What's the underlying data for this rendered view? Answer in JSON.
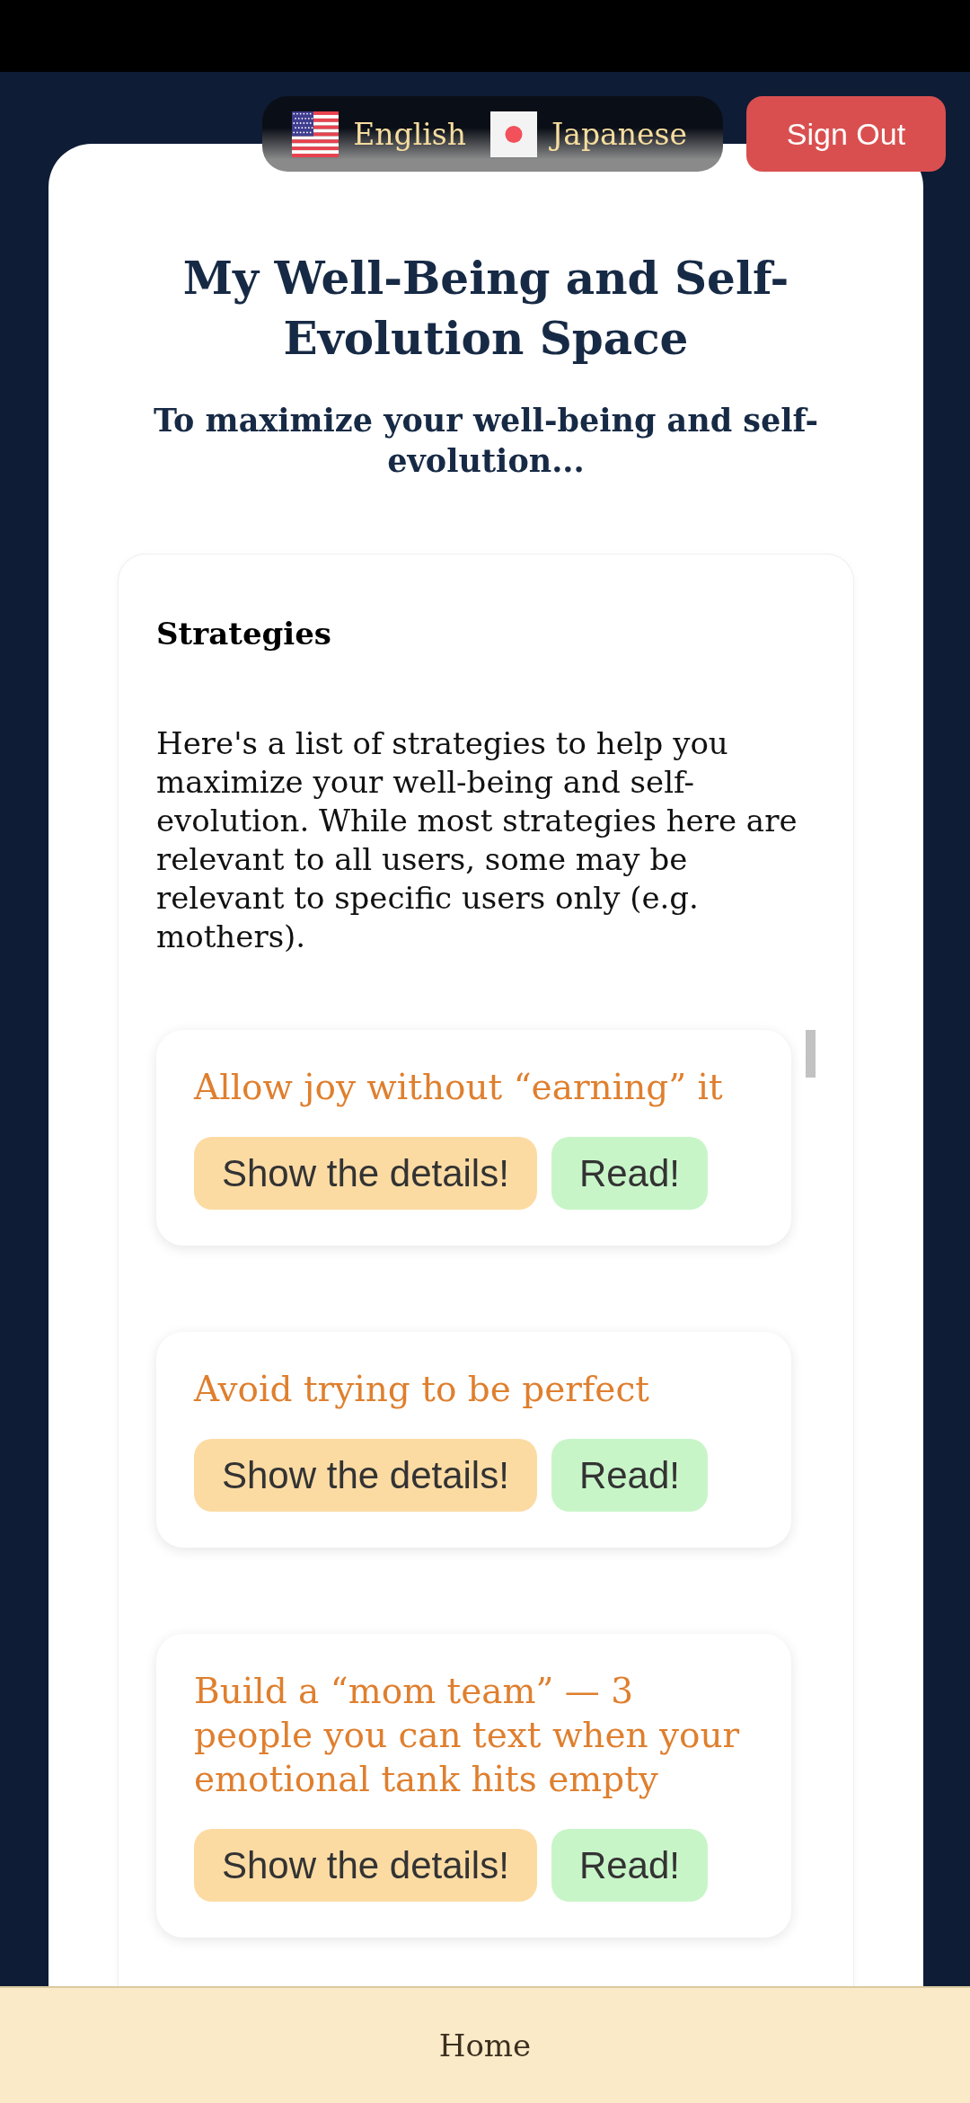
{
  "language_switcher": {
    "options": [
      {
        "label": "English",
        "kind": "us"
      },
      {
        "label": "Japanese",
        "kind": "jp"
      }
    ]
  },
  "sign_out_button": {
    "label": "Sign Out"
  },
  "header": {
    "title": "My Well-Being and Self-Evolution Space",
    "subtitle": "To maximize your well-being and self-evolution..."
  },
  "strategies": {
    "heading": "Strategies",
    "description": "Here's a list of strategies to help you maximize your well-being and self-evolution. While most strategies here are relevant to all users, some may be relevant to specific users only (e.g. mothers).",
    "items": [
      {
        "title": "Allow joy without “earning” it",
        "details_button": "Show the details!",
        "read_button": "Read!"
      },
      {
        "title": "Avoid trying to be perfect",
        "details_button": "Show the details!",
        "read_button": "Read!"
      },
      {
        "title": "Build a “mom team” — 3\npeople you can text when your emotional tank hits empty",
        "details_button": "Show the details!",
        "read_button": "Read!"
      }
    ]
  },
  "bottom_nav": {
    "items": [
      {
        "label": "Home"
      }
    ]
  }
}
